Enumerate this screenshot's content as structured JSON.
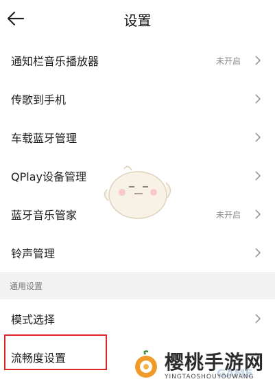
{
  "header": {
    "title": "设置"
  },
  "settings": [
    {
      "label": "通知栏音乐播放器",
      "value": "未开启"
    },
    {
      "label": "传歌到手机",
      "value": ""
    },
    {
      "label": "车载蓝牙管理",
      "value": ""
    },
    {
      "label": "QPlay设备管理",
      "value": ""
    },
    {
      "label": "蓝牙音乐管家",
      "value": "未开启"
    },
    {
      "label": "铃声管理",
      "value": ""
    }
  ],
  "general_section": {
    "title": "通用设置",
    "items": [
      {
        "label": "模式选择"
      },
      {
        "label": "流畅度设置"
      }
    ]
  },
  "watermark": {
    "brand": "樱桃手游网",
    "sub": "YINGTAOSHOUYOUWANG",
    "overlay": "GAME"
  },
  "colors": {
    "highlight_border": "#e02525",
    "section_bg": "#f2f2f2"
  },
  "icons": [
    "back-arrow-icon",
    "chevron-right-icon",
    "mascot-illustration",
    "cherry-logo"
  ]
}
